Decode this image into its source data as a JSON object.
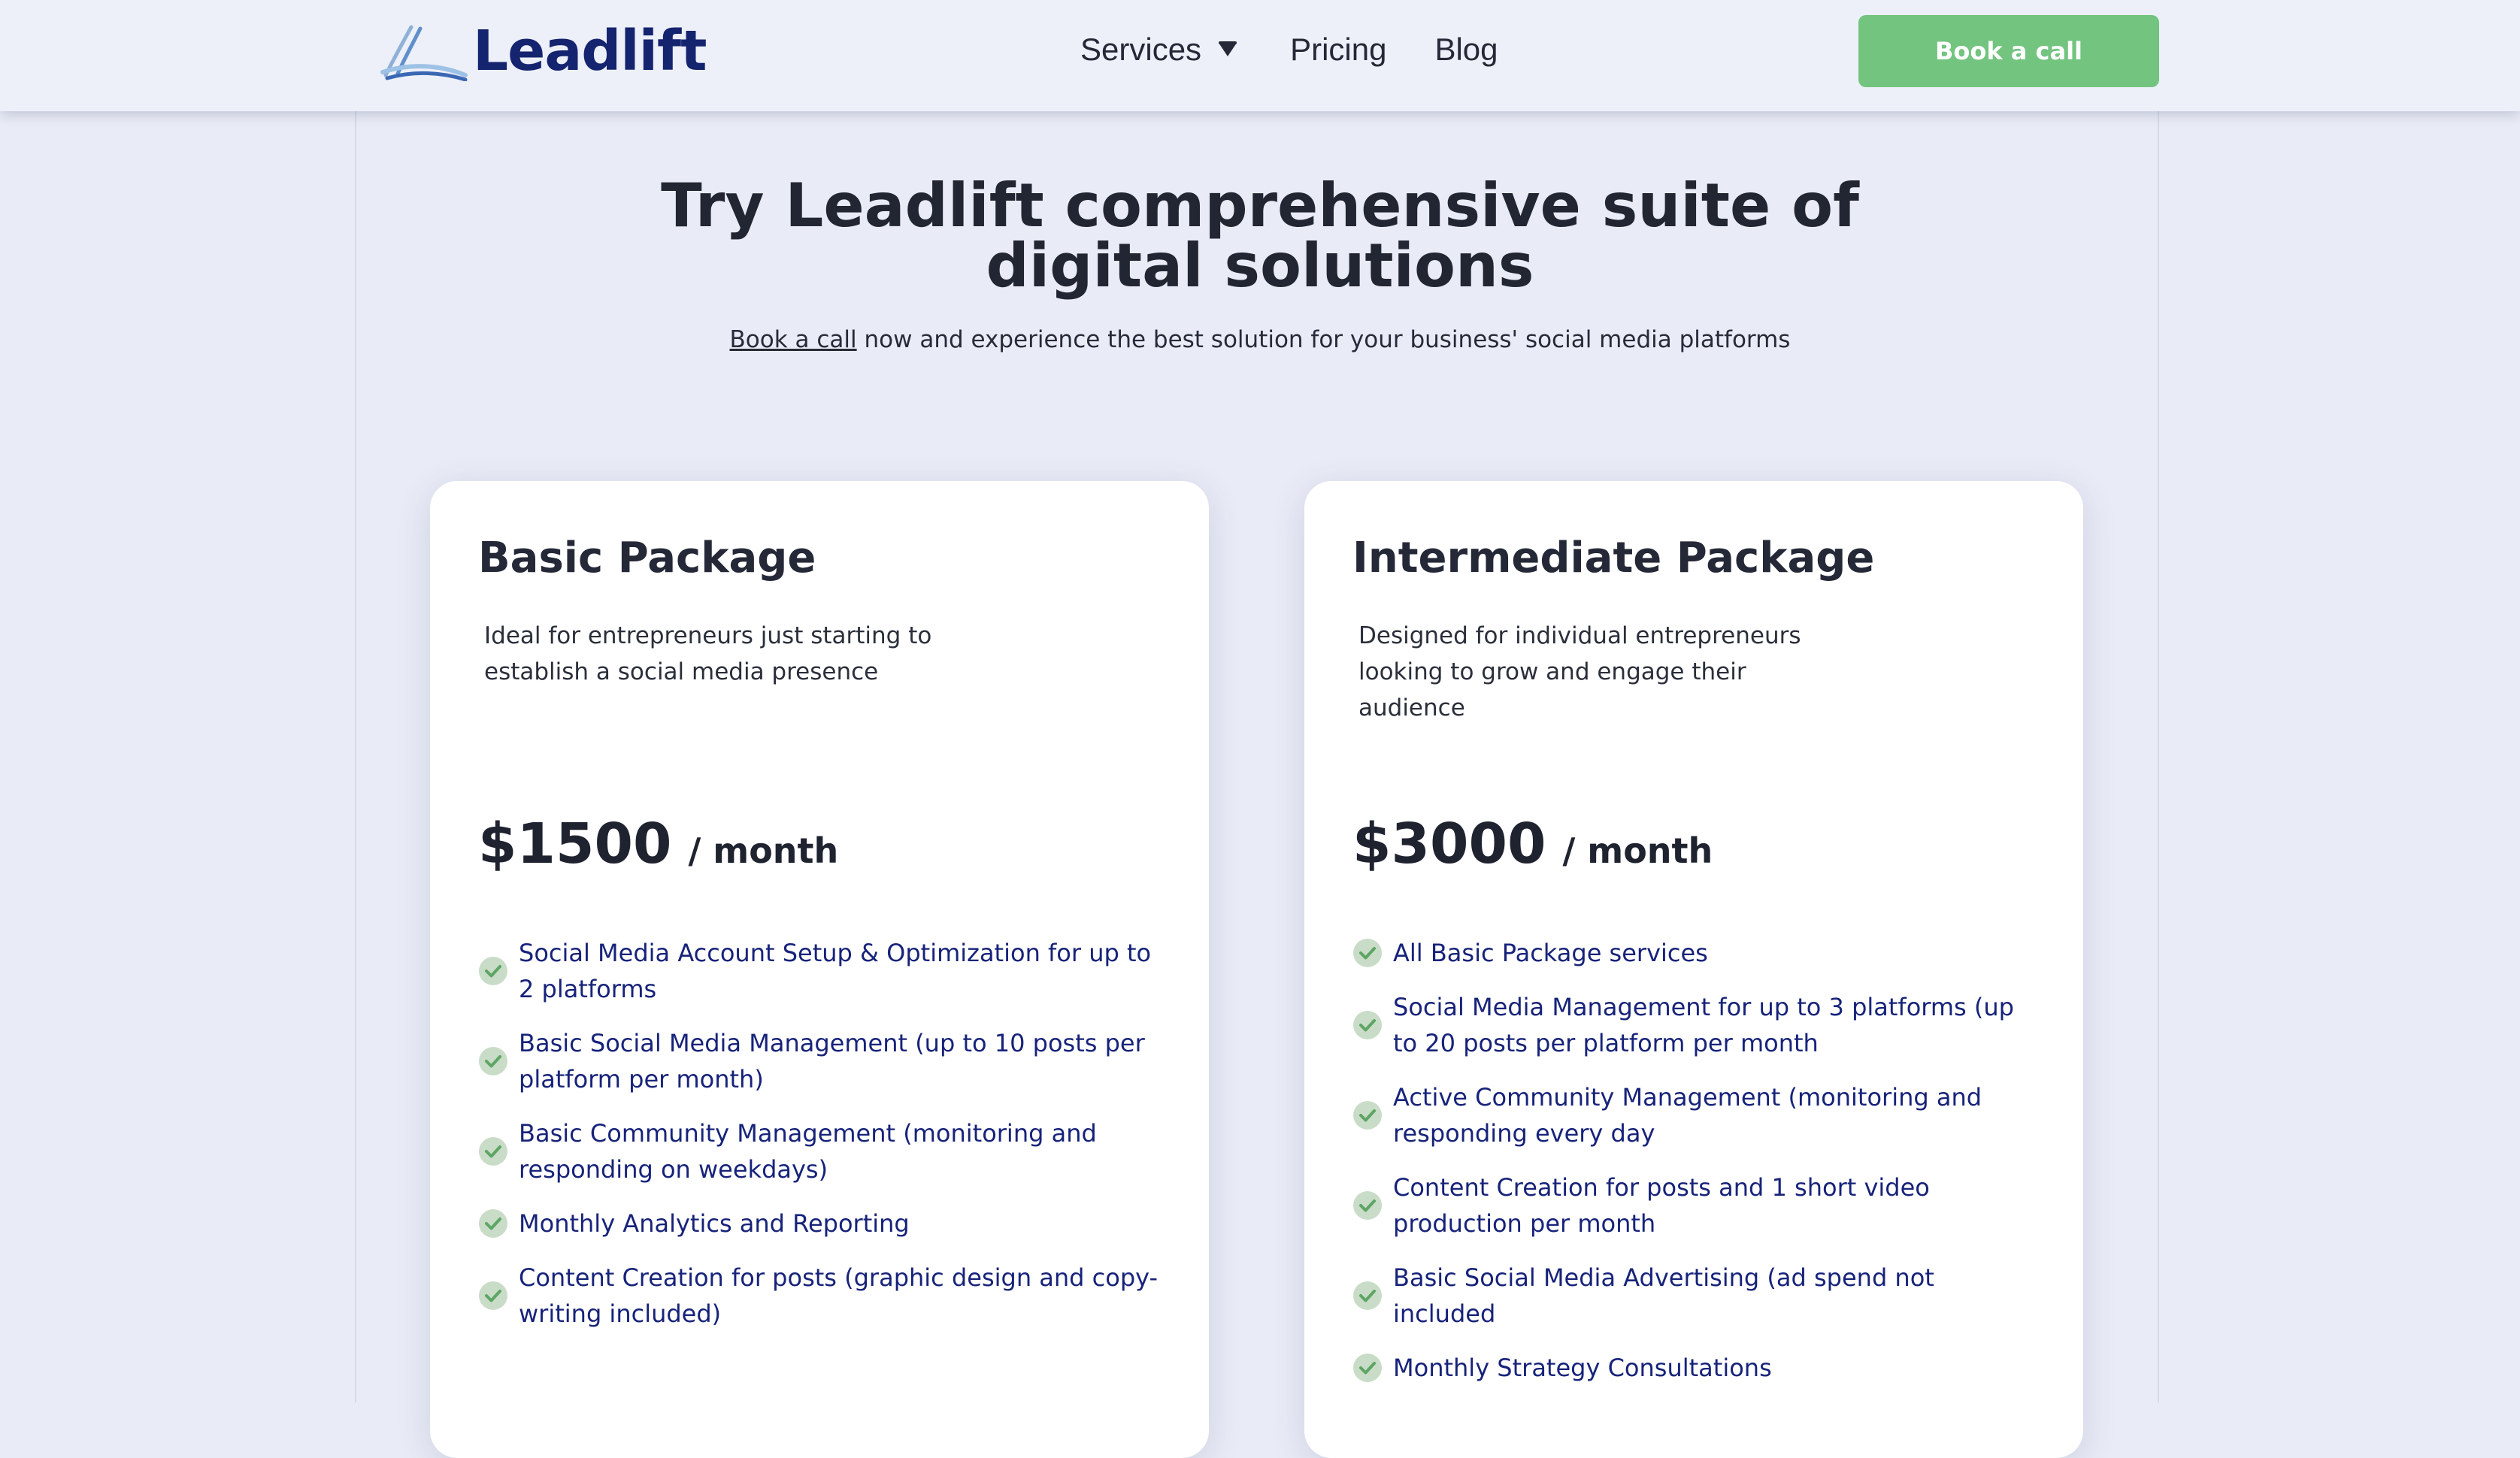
{
  "header": {
    "logo_text": "Leadlift",
    "nav": [
      {
        "label": "Services",
        "has_dropdown": true
      },
      {
        "label": "Pricing"
      },
      {
        "label": "Blog"
      }
    ],
    "cta_label": "Book a call"
  },
  "hero": {
    "title_line1": "Try Leadlift comprehensive suite of",
    "title_line2": "digital solutions",
    "subtitle_link": "Book a call",
    "subtitle_rest": " now and experience the best solution for your business' social media platforms"
  },
  "packages": [
    {
      "title": "Basic Package",
      "desc_line1": "Ideal for entrepreneurs just starting to",
      "desc_line2": "establish a social media presence",
      "price": "$1500",
      "period": "/ month",
      "features": [
        "Social Media Account Setup & Optimization for up to 2 platforms",
        "Basic Social Media Management (up to 10 posts per platform per month)",
        "Basic Community Management (monitoring and responding on weekdays)",
        "Monthly Analytics and Reporting",
        "Content Creation for posts (graphic design and copy-writing included)"
      ]
    },
    {
      "title": "Intermediate Package",
      "desc_line1": "Designed for individual entrepreneurs",
      "desc_line2": "looking to grow and engage their audience",
      "price": "$3000",
      "period": "/ month",
      "features": [
        "All Basic Package services",
        "Social Media Management for up to 3 platforms (up to 20 posts per platform per month",
        "Active Community Management (monitoring and responding every day",
        "Content Creation for posts and 1 short video production per month",
        "Basic Social Media Advertising (ad spend not included",
        "Monthly Strategy Consultations"
      ]
    }
  ],
  "colors": {
    "brand_navy": "#15246f",
    "cta_green": "#72c47f",
    "feature_text": "#17237a",
    "page_bg": "#e9ecf6"
  },
  "icons": {
    "logo_mark": "swoosh-logo-icon",
    "dropdown": "chevron-down-icon",
    "feature_check": "check-circle-icon"
  }
}
